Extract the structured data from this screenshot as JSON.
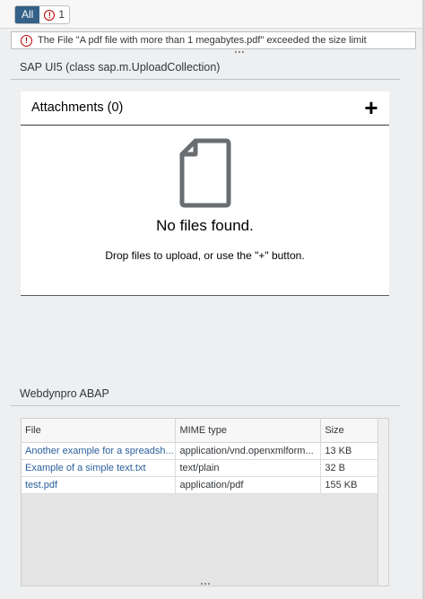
{
  "filter_bar": {
    "all_label": "All",
    "error_count": "1"
  },
  "message": {
    "text": "The File \"A pdf file with more than 1 megabytes.pdf\" exceeded the size limit",
    "icon": "error-icon"
  },
  "sapui5": {
    "section_title": "SAP UI5 (class sap.m.UploadCollection)",
    "header_title": "Attachments (0)",
    "add_icon": "+",
    "no_data_title": "No files found.",
    "no_data_description": "Drop files to upload, or use the \"+\" button."
  },
  "webdynpro": {
    "section_title": "Webdynpro ABAP",
    "columns": [
      "File",
      "MIME type",
      "Size"
    ],
    "rows": [
      {
        "file": "Another example for a spreadsh...",
        "mime": "application/vnd.openxmlform...",
        "size": "13 KB"
      },
      {
        "file": "Example of a simple text.txt",
        "mime": "text/plain",
        "size": "32 B"
      },
      {
        "file": "test.pdf",
        "mime": "application/pdf",
        "size": "155 KB"
      }
    ]
  },
  "colors": {
    "accent": "#346187",
    "error": "#bb0000",
    "link": "#2a5e9b"
  }
}
